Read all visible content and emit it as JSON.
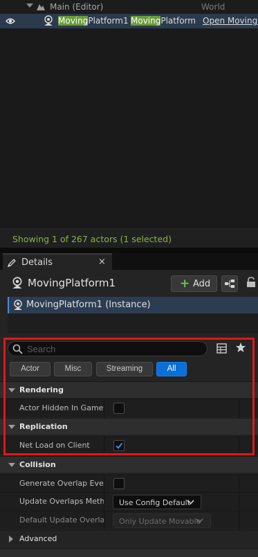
{
  "outliner": {
    "level_row": {
      "name": "Main (Editor)",
      "type": "World"
    },
    "actor_row": {
      "name_highlight": "Moving",
      "name_rest": "Platform1",
      "type_highlight": "Moving",
      "type_rest": "Platform",
      "link": "Open MovingP"
    },
    "status": "Showing 1 of 267 actors (1 selected)"
  },
  "details": {
    "tab_label": "Details",
    "tab_close": "×",
    "actor_name": "MovingPlatform1",
    "add_label": "Add",
    "component": "MovingPlatform1 (Instance)",
    "search_placeholder": "Search",
    "filters": [
      "Actor",
      "Misc",
      "Streaming",
      "All"
    ],
    "active_filter": "All",
    "categories": {
      "rendering": {
        "label": "Rendering",
        "props": [
          {
            "name": "Actor Hidden In Game",
            "checked": false
          }
        ]
      },
      "replication": {
        "label": "Replication",
        "props": [
          {
            "name": "Net Load on Client",
            "checked": true
          }
        ]
      },
      "collision": {
        "label": "Collision",
        "props": [
          {
            "name": "Generate Overlap Even...",
            "checked": false
          },
          {
            "name": "Update Overlaps Meth...",
            "value": "Use Config Default"
          },
          {
            "name": "Default Update Overla...",
            "value": "Only Update Movable"
          }
        ]
      },
      "advanced": {
        "label": "Advanced"
      }
    }
  },
  "colors": {
    "accent": "#0a70d8",
    "highlight": "#6a9c3a",
    "status_text": "#8fae4f",
    "selection": "#2b3b4d",
    "red_frame": "#e01818"
  },
  "icons": [
    "eye-icon",
    "level-icon",
    "actor-icon",
    "pencil-icon",
    "close-icon",
    "plus-icon",
    "blueprint-icon",
    "lock-icon",
    "search-icon",
    "table-icon",
    "star-icon",
    "checkmark-icon",
    "chevron-down-icon"
  ]
}
